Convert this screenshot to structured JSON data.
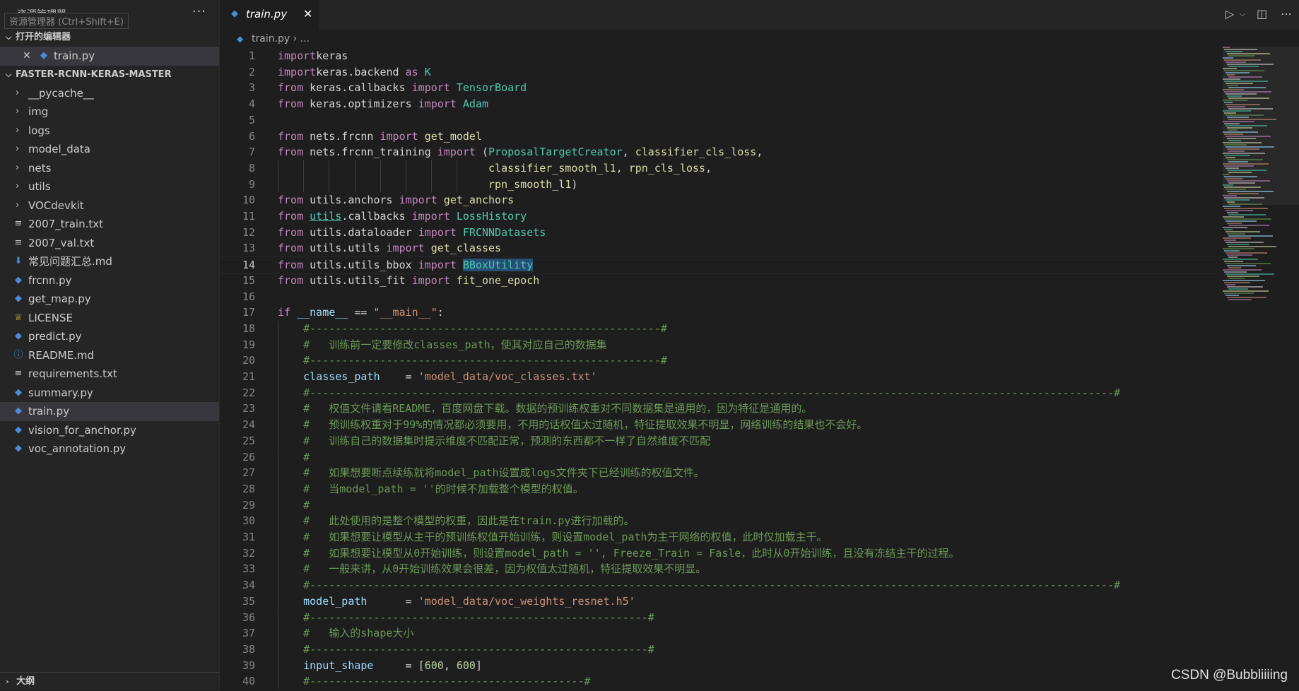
{
  "sidebar": {
    "title": "资源管理器",
    "tooltip": "资源管理器 (Ctrl+Shift+E)",
    "more": "···",
    "open_editors_label": "打开的编辑器",
    "open_editor_file": "train.py",
    "project_label": "FASTER-RCNN-KERAS-MASTER",
    "folders": [
      "__pycache__",
      "img",
      "logs",
      "model_data",
      "nets",
      "utils",
      "VOCdevkit"
    ],
    "files": [
      {
        "name": "2007_train.txt",
        "icon": "text-file-icon"
      },
      {
        "name": "2007_val.txt",
        "icon": "text-file-icon"
      },
      {
        "name": "常见问题汇总.md",
        "icon": "markdown-icon"
      },
      {
        "name": "frcnn.py",
        "icon": "python-icon"
      },
      {
        "name": "get_map.py",
        "icon": "python-icon"
      },
      {
        "name": "LICENSE",
        "icon": "license-icon"
      },
      {
        "name": "predict.py",
        "icon": "python-icon"
      },
      {
        "name": "README.md",
        "icon": "info-icon"
      },
      {
        "name": "requirements.txt",
        "icon": "text-file-icon"
      },
      {
        "name": "summary.py",
        "icon": "python-icon"
      },
      {
        "name": "train.py",
        "icon": "python-icon",
        "selected": true
      },
      {
        "name": "vision_for_anchor.py",
        "icon": "python-icon"
      },
      {
        "name": "voc_annotation.py",
        "icon": "python-icon"
      }
    ],
    "outline_label": "大纲"
  },
  "tab": {
    "label": "train.py"
  },
  "breadcrumb": {
    "file": "train.py",
    "rest": "..."
  },
  "watermark": "CSDN @Bubbliiiing",
  "colors": {
    "kw": "#c586c0",
    "kb": "#569cd6",
    "mod": "#4ec9b0",
    "fn": "#dcdcaa",
    "var": "#9cdcfe",
    "str": "#ce9178",
    "num": "#b5cea8",
    "cm": "#6a9955"
  },
  "current_line": 14,
  "code": [
    {
      "n": "1",
      "t": [
        [
          "kw",
          "import"
        ],
        [
          "",
          "keras"
        ]
      ]
    },
    {
      "n": "2",
      "t": [
        [
          "kw",
          "import"
        ],
        [
          "",
          "keras.backend "
        ],
        [
          "kw",
          "as"
        ],
        [
          "mod",
          " K"
        ]
      ]
    },
    {
      "n": "3",
      "t": [
        [
          "kw",
          "from"
        ],
        [
          "",
          " keras.callbacks "
        ],
        [
          "kw",
          "import"
        ],
        [
          "mod",
          " TensorBoard"
        ]
      ]
    },
    {
      "n": "4",
      "t": [
        [
          "kw",
          "from"
        ],
        [
          "",
          " keras.optimizers "
        ],
        [
          "kw",
          "import"
        ],
        [
          "mod",
          " Adam"
        ]
      ]
    },
    {
      "n": "5",
      "t": []
    },
    {
      "n": "6",
      "t": [
        [
          "kw",
          "from"
        ],
        [
          "",
          " nets.frcnn "
        ],
        [
          "kw",
          "import"
        ],
        [
          "fn",
          " get_model"
        ]
      ]
    },
    {
      "n": "7",
      "t": [
        [
          "kw",
          "from"
        ],
        [
          "",
          " nets.frcnn_training "
        ],
        [
          "kw",
          "import"
        ],
        [
          "",
          " ("
        ],
        [
          "mod",
          "ProposalTargetCreator"
        ],
        [
          "",
          ", "
        ],
        [
          "fn",
          "classifier_cls_loss"
        ],
        [
          "",
          ","
        ]
      ]
    },
    {
      "n": "8",
      "t": [
        [
          "",
          "                                 "
        ],
        [
          "fn",
          "classifier_smooth_l1"
        ],
        [
          "",
          ", "
        ],
        [
          "fn",
          "rpn_cls_loss"
        ],
        [
          "",
          ","
        ]
      ],
      "guides": 8
    },
    {
      "n": "9",
      "t": [
        [
          "",
          "                                 "
        ],
        [
          "fn",
          "rpn_smooth_l1"
        ],
        [
          "",
          ")"
        ]
      ],
      "guides": 8
    },
    {
      "n": "10",
      "t": [
        [
          "kw",
          "from"
        ],
        [
          "",
          " utils.anchors "
        ],
        [
          "kw",
          "import"
        ],
        [
          "fn",
          " get_anchors"
        ]
      ]
    },
    {
      "n": "11",
      "t": [
        [
          "kw",
          "from"
        ],
        [
          "",
          " "
        ],
        [
          "link",
          "utils"
        ],
        [
          "",
          ".callbacks "
        ],
        [
          "kw",
          "import"
        ],
        [
          "mod",
          " LossHistory"
        ]
      ]
    },
    {
      "n": "12",
      "t": [
        [
          "kw",
          "from"
        ],
        [
          "",
          " utils.dataloader "
        ],
        [
          "kw",
          "import"
        ],
        [
          "mod",
          " FRCNNDatasets"
        ]
      ]
    },
    {
      "n": "13",
      "t": [
        [
          "kw",
          "from"
        ],
        [
          "",
          " utils.utils "
        ],
        [
          "kw",
          "import"
        ],
        [
          "fn",
          " get_classes"
        ]
      ]
    },
    {
      "n": "14",
      "t": [
        [
          "kw",
          "from"
        ],
        [
          "",
          " utils.utils_bbox "
        ],
        [
          "kw",
          "import"
        ],
        [
          "",
          " "
        ],
        [
          "hlmod",
          "BBoxUtility"
        ]
      ]
    },
    {
      "n": "15",
      "t": [
        [
          "kw",
          "from"
        ],
        [
          "",
          " utils.utils_fit "
        ],
        [
          "kw",
          "import"
        ],
        [
          "fn",
          " fit_one_epoch"
        ]
      ]
    },
    {
      "n": "16",
      "t": []
    },
    {
      "n": "17",
      "t": [
        [
          "kw",
          "if"
        ],
        [
          "var",
          " __name__"
        ],
        [
          "",
          " == "
        ],
        [
          "str",
          "\"__main__\""
        ],
        [
          "",
          ":"
        ]
      ]
    },
    {
      "n": "18",
      "t": [
        [
          "",
          "    "
        ],
        [
          "cm",
          "#-------------------------------------------------------#"
        ]
      ],
      "guides": 1
    },
    {
      "n": "19",
      "t": [
        [
          "",
          "    "
        ],
        [
          "cm",
          "#   训练前一定要修改classes_path，使其对应自己的数据集"
        ]
      ],
      "guides": 1
    },
    {
      "n": "20",
      "t": [
        [
          "",
          "    "
        ],
        [
          "cm",
          "#-------------------------------------------------------#"
        ]
      ],
      "guides": 1
    },
    {
      "n": "21",
      "t": [
        [
          "",
          "    "
        ],
        [
          "var",
          "classes_path"
        ],
        [
          "",
          "    = "
        ],
        [
          "str",
          "'model_data/voc_classes.txt'"
        ]
      ],
      "guides": 1
    },
    {
      "n": "22",
      "t": [
        [
          "",
          "    "
        ],
        [
          "cm",
          "#------------------------------------------------------------------------------------------------------------------------------#"
        ]
      ],
      "guides": 1
    },
    {
      "n": "23",
      "t": [
        [
          "",
          "    "
        ],
        [
          "cm",
          "#   权值文件请看README，百度网盘下载。数据的预训练权重对不同数据集是通用的，因为特征是通用的。"
        ]
      ],
      "guides": 1
    },
    {
      "n": "24",
      "t": [
        [
          "",
          "    "
        ],
        [
          "cm",
          "#   预训练权重对于99%的情况都必须要用，不用的话权值太过随机，特征提取效果不明显，网络训练的结果也不会好。"
        ]
      ],
      "guides": 1
    },
    {
      "n": "25",
      "t": [
        [
          "",
          "    "
        ],
        [
          "cm",
          "#   训练自己的数据集时提示维度不匹配正常，预测的东西都不一样了自然维度不匹配"
        ]
      ],
      "guides": 1
    },
    {
      "n": "26",
      "t": [
        [
          "",
          "    "
        ],
        [
          "cm",
          "#"
        ]
      ],
      "guides": 1
    },
    {
      "n": "27",
      "t": [
        [
          "",
          "    "
        ],
        [
          "cm",
          "#   如果想要断点续练就将model_path设置成logs文件夹下已经训练的权值文件。"
        ]
      ],
      "guides": 1
    },
    {
      "n": "28",
      "t": [
        [
          "",
          "    "
        ],
        [
          "cm",
          "#   当model_path = ''的时候不加载整个模型的权值。"
        ]
      ],
      "guides": 1
    },
    {
      "n": "29",
      "t": [
        [
          "",
          "    "
        ],
        [
          "cm",
          "#"
        ]
      ],
      "guides": 1
    },
    {
      "n": "30",
      "t": [
        [
          "",
          "    "
        ],
        [
          "cm",
          "#   此处使用的是整个模型的权重，因此是在train.py进行加载的。"
        ]
      ],
      "guides": 1
    },
    {
      "n": "31",
      "t": [
        [
          "",
          "    "
        ],
        [
          "cm",
          "#   如果想要让模型从主干的预训练权值开始训练，则设置model_path为主干网络的权值，此时仅加载主干。"
        ]
      ],
      "guides": 1
    },
    {
      "n": "32",
      "t": [
        [
          "",
          "    "
        ],
        [
          "cm",
          "#   如果想要让模型从0开始训练，则设置model_path = '', Freeze_Train = Fasle，此时从0开始训练，且没有冻结主干的过程。"
        ]
      ],
      "guides": 1
    },
    {
      "n": "33",
      "t": [
        [
          "",
          "    "
        ],
        [
          "cm",
          "#   一般来讲，从0开始训练效果会很差，因为权值太过随机，特征提取效果不明显。"
        ]
      ],
      "guides": 1
    },
    {
      "n": "34",
      "t": [
        [
          "",
          "    "
        ],
        [
          "cm",
          "#------------------------------------------------------------------------------------------------------------------------------#"
        ]
      ],
      "guides": 1
    },
    {
      "n": "35",
      "t": [
        [
          "",
          "    "
        ],
        [
          "var",
          "model_path"
        ],
        [
          "",
          "      = "
        ],
        [
          "str",
          "'model_data/voc_weights_resnet.h5'"
        ]
      ],
      "guides": 1
    },
    {
      "n": "36",
      "t": [
        [
          "",
          "    "
        ],
        [
          "cm",
          "#-----------------------------------------------------#"
        ]
      ],
      "guides": 1
    },
    {
      "n": "37",
      "t": [
        [
          "",
          "    "
        ],
        [
          "cm",
          "#   输入的shape大小"
        ]
      ],
      "guides": 1
    },
    {
      "n": "38",
      "t": [
        [
          "",
          "    "
        ],
        [
          "cm",
          "#-----------------------------------------------------#"
        ]
      ],
      "guides": 1
    },
    {
      "n": "39",
      "t": [
        [
          "",
          "    "
        ],
        [
          "var",
          "input_shape"
        ],
        [
          "",
          "     = ["
        ],
        [
          "num",
          "600"
        ],
        [
          "",
          ", "
        ],
        [
          "num",
          "600"
        ],
        [
          "",
          "]"
        ]
      ],
      "guides": 1
    },
    {
      "n": "40",
      "t": [
        [
          "",
          "    "
        ],
        [
          "cm",
          "#-------------------------------------------#"
        ]
      ],
      "guides": 1
    }
  ]
}
